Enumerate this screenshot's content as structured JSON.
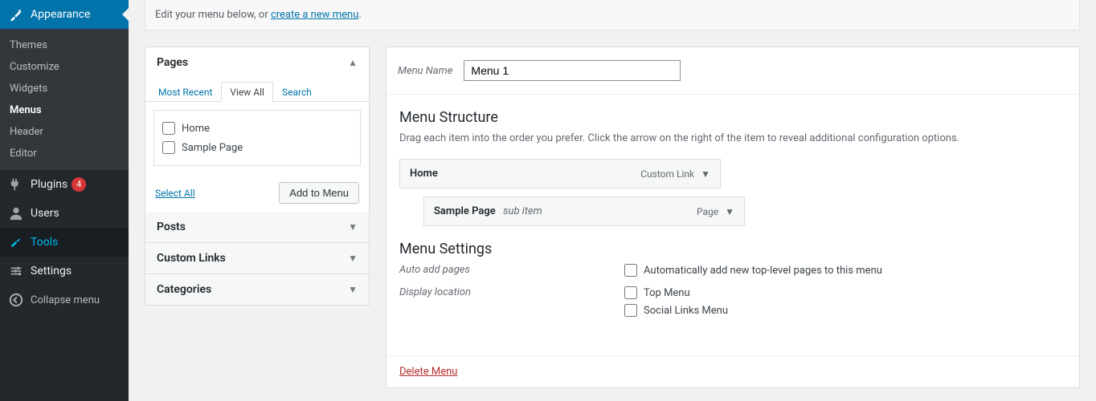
{
  "sidebar": {
    "appearance": "Appearance",
    "sub": [
      "Themes",
      "Customize",
      "Widgets",
      "Menus",
      "Header",
      "Editor"
    ],
    "plugins": "Plugins",
    "plugins_badge": "4",
    "users": "Users",
    "tools": "Tools",
    "settings": "Settings",
    "collapse": "Collapse menu"
  },
  "notice": {
    "text": "Edit your menu below, or ",
    "link": "create a new menu",
    "period": "."
  },
  "accordion": {
    "pages": "Pages",
    "posts": "Posts",
    "custom_links": "Custom Links",
    "categories": "Categories",
    "tabs": {
      "recent": "Most Recent",
      "viewall": "View All",
      "search": "Search"
    },
    "items": [
      "Home",
      "Sample Page"
    ],
    "select_all": "Select All",
    "add": "Add to Menu"
  },
  "menu": {
    "name_label": "Menu Name",
    "name_value": "Menu 1",
    "structure_title": "Menu Structure",
    "structure_hint": "Drag each item into the order you prefer. Click the arrow on the right of the item to reveal additional configuration options.",
    "items": [
      {
        "title": "Home",
        "type": "Custom Link",
        "sub": ""
      },
      {
        "title": "Sample Page",
        "type": "Page",
        "sub": "sub item"
      }
    ],
    "settings_title": "Menu Settings",
    "auto_add_label": "Auto add pages",
    "auto_add_opt": "Automatically add new top-level pages to this menu",
    "location_label": "Display location",
    "locations": [
      "Top Menu",
      "Social Links Menu"
    ],
    "delete": "Delete Menu"
  }
}
